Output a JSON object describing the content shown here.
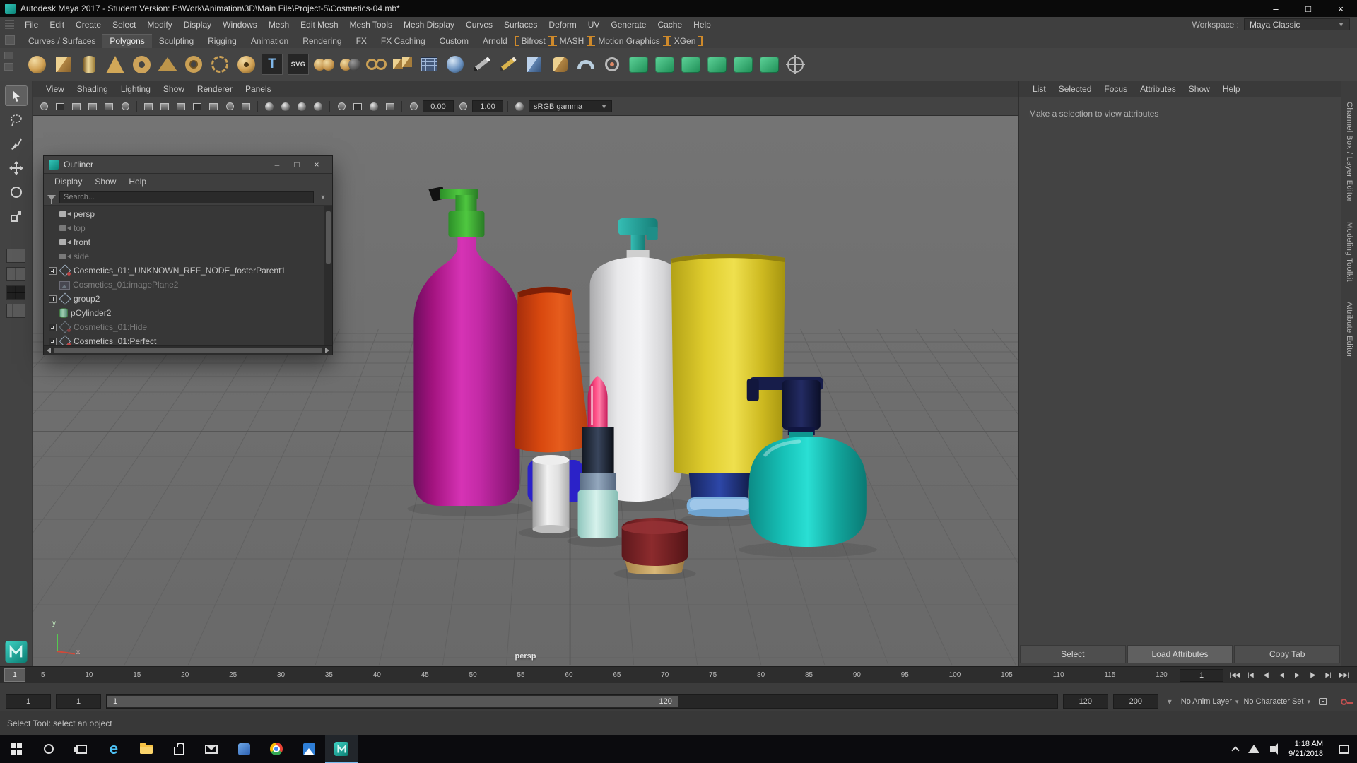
{
  "window": {
    "title": "Autodesk Maya 2017 - Student Version: F:\\Work\\Animation\\3D\\Main File\\Project-5\\Cosmetics-04.mb*"
  },
  "glyphs": {
    "minimize": "–",
    "maximize": "□",
    "close": "×",
    "dropdown": "▼",
    "caret": "▾",
    "type_tool": "T",
    "svg_tool": "SVG",
    "edge_letter": "e"
  },
  "menubar": {
    "items": [
      "File",
      "Edit",
      "Create",
      "Select",
      "Modify",
      "Display",
      "Windows",
      "Mesh",
      "Edit Mesh",
      "Mesh Tools",
      "Mesh Display",
      "Curves",
      "Surfaces",
      "Deform",
      "UV",
      "Generate",
      "Cache",
      "Help"
    ],
    "workspace_label": "Workspace :",
    "workspace_value": "Maya Classic"
  },
  "shelf": {
    "tabs": [
      "Curves / Surfaces",
      "Polygons",
      "Sculpting",
      "Rigging",
      "Animation",
      "Rendering",
      "FX",
      "FX Caching",
      "Custom",
      "Arnold",
      "Bifrost",
      "MASH",
      "Motion Graphics",
      "XGen"
    ]
  },
  "panel": {
    "menus": [
      "View",
      "Shading",
      "Lighting",
      "Show",
      "Renderer",
      "Panels"
    ]
  },
  "viewport": {
    "exposure": "0.00",
    "gamma": "1.00",
    "colorspace": "sRGB gamma",
    "camera_label": "persp",
    "axis_y": "y",
    "axis_x": "x"
  },
  "outliner": {
    "title": "Outliner",
    "menus": [
      "Display",
      "Show",
      "Help"
    ],
    "search_placeholder": "Search...",
    "items": [
      {
        "label": "persp"
      },
      {
        "label": "top"
      },
      {
        "label": "front"
      },
      {
        "label": "side"
      },
      {
        "label": "Cosmetics_01:_UNKNOWN_REF_NODE_fosterParent1"
      },
      {
        "label": "Cosmetics_01:imagePlane2"
      },
      {
        "label": "group2"
      },
      {
        "label": "pCylinder2"
      },
      {
        "label": "Cosmetics_01:Hide"
      },
      {
        "label": "Cosmetics_01:Perfect"
      }
    ]
  },
  "attribute_editor": {
    "menus": [
      "List",
      "Selected",
      "Focus",
      "Attributes",
      "Show",
      "Help"
    ],
    "message": "Make a selection to view attributes",
    "buttons": [
      "Select",
      "Load Attributes",
      "Copy Tab"
    ]
  },
  "right_tabs": [
    "Channel Box / Layer Editor",
    "Modeling Toolkit",
    "Attribute Editor"
  ],
  "timeline": {
    "playhead": "1",
    "ticks": [
      "5",
      "10",
      "15",
      "20",
      "25",
      "30",
      "35",
      "40",
      "45",
      "50",
      "55",
      "60",
      "65",
      "70",
      "75",
      "80",
      "85",
      "90",
      "95",
      "100",
      "105",
      "110",
      "115",
      "120"
    ],
    "current_frame": "1",
    "playback": [
      "|◀◀",
      "|◀",
      "◀|",
      "◀",
      "▶",
      "|▶",
      "▶|",
      "▶▶|"
    ]
  },
  "range_slider": {
    "field1": "1",
    "field2": "1",
    "bar_start": "1",
    "bar_end": "120",
    "field3": "120",
    "field4": "200",
    "anim_layer": "No Anim Layer",
    "character_set": "No Character Set"
  },
  "help_line": {
    "text": "Select Tool: select an object"
  },
  "taskbar": {
    "time": "1:18 AM",
    "date": "9/21/2018"
  }
}
